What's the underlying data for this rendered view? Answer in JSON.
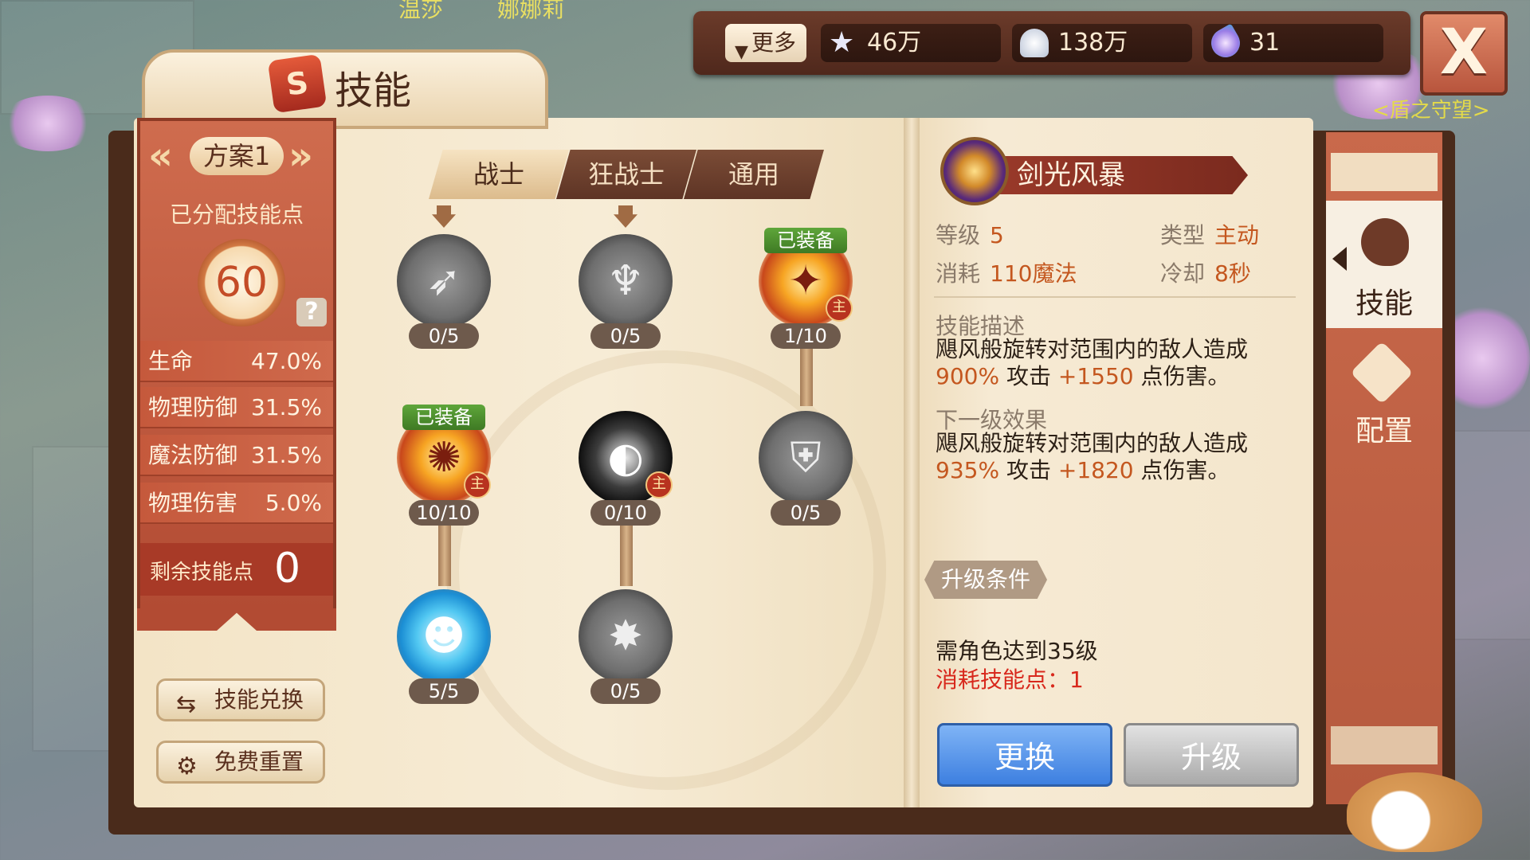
{
  "resources": {
    "more_label": "更多",
    "stars": "46万",
    "shells": "138万",
    "gems": "31"
  },
  "close_label": "X",
  "title": "技能",
  "scene": {
    "npc_label_1": "娜娜莉",
    "npc_label_2": "温莎",
    "guild_label": "<盾之守望>"
  },
  "plan": {
    "name": "方案1",
    "allocated_label": "已分配技能点",
    "allocated_points": "60",
    "help_icon": "?",
    "stats": [
      {
        "label": "生命",
        "value": "47.0%"
      },
      {
        "label": "物理防御",
        "value": "31.5%"
      },
      {
        "label": "魔法防御",
        "value": "31.5%"
      },
      {
        "label": "物理伤害",
        "value": "5.0%"
      }
    ],
    "remaining_label": "剩余技能点",
    "remaining_value": "0"
  },
  "side_buttons": {
    "exchange": "技能兑换",
    "reset": "免费重置"
  },
  "class_tabs": [
    "战士",
    "狂战士",
    "通用"
  ],
  "skill_tree": {
    "equipped_tag": "已装备",
    "main_badge": "主",
    "nodes": [
      {
        "level": "0/5"
      },
      {
        "level": "0/5"
      },
      {
        "level": "1/10"
      },
      {
        "level": "10/10"
      },
      {
        "level": "0/10"
      },
      {
        "level": "0/5"
      },
      {
        "level": "5/5"
      },
      {
        "level": "0/5"
      }
    ]
  },
  "detail": {
    "skill_name": "剑光风暴",
    "level_label": "等级",
    "level_value": "5",
    "type_label": "类型",
    "type_value": "主动",
    "cost_label": "消耗",
    "cost_value": "110魔法",
    "cooldown_label": "冷却",
    "cooldown_value": "8秒",
    "desc_title": "技能描述",
    "desc_pre": "飓风般旋转对范围内的敌人造成",
    "desc_pct": "900%",
    "desc_mid": "攻击",
    "desc_add": "+1550",
    "desc_post": "点伤害。",
    "next_title": "下一级效果",
    "next_pre": "飓风般旋转对范围内的敌人造成",
    "next_pct": "935%",
    "next_mid": "攻击",
    "next_add": "+1820",
    "next_post": "点伤害。",
    "cond_tag": "升级条件",
    "cond_level": "需角色达到35级",
    "cond_points": "消耗技能点：1",
    "swap_button": "更换",
    "upgrade_button": "升级"
  },
  "side_tabs": {
    "skill": "技能",
    "config": "配置"
  }
}
